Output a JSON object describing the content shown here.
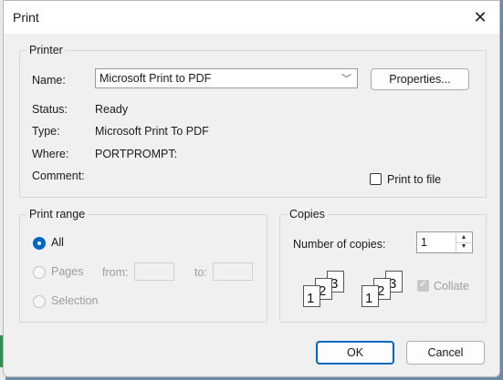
{
  "window": {
    "title": "Print"
  },
  "printer": {
    "group_label": "Printer",
    "name_label": "Name:",
    "name_value": "Microsoft Print to PDF",
    "properties_label": "Properties...",
    "status_label": "Status:",
    "status_value": "Ready",
    "type_label": "Type:",
    "type_value": "Microsoft Print To PDF",
    "where_label": "Where:",
    "where_value": "PORTPROMPT:",
    "comment_label": "Comment:",
    "print_to_file_label": "Print to file"
  },
  "range": {
    "group_label": "Print range",
    "all_label": "All",
    "pages_label": "Pages",
    "from_label": "from:",
    "to_label": "to:",
    "selection_label": "Selection"
  },
  "copies": {
    "group_label": "Copies",
    "number_label": "Number of copies:",
    "number_value": "1",
    "collate_label": "Collate",
    "icon_pages": [
      "1",
      "2",
      "3"
    ]
  },
  "footer": {
    "ok_label": "OK",
    "cancel_label": "Cancel"
  },
  "icons": [
    "close-icon",
    "chevron-down-icon",
    "spin-up-icon",
    "spin-down-icon",
    "collate-pages-icon"
  ]
}
